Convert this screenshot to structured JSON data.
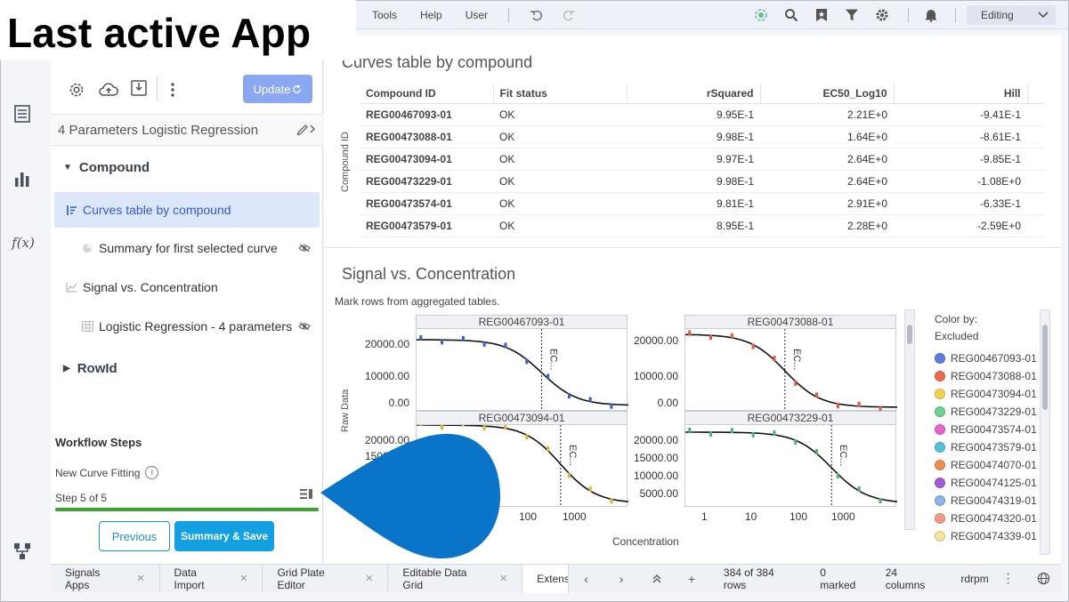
{
  "caption": "Last active App",
  "topbar": {
    "menus": [
      "Tools",
      "Help",
      "User"
    ],
    "mode": "Editing"
  },
  "panel": {
    "update_label": "Update",
    "app_title": "4 Parameters Logistic Regression",
    "groups": {
      "compound": "Compound",
      "rowid": "RowId"
    },
    "items": {
      "curves_table": "Curves table by compound",
      "summary": "Summary for first selected curve",
      "signal_vs_conc": "Signal vs. Concentration",
      "logistic": "Logistic Regression - 4 parameters"
    },
    "workflow": {
      "title": "Workflow Steps",
      "name": "New Curve Fitting",
      "step": "Step 5 of 5",
      "progress": 1.0,
      "previous": "Previous",
      "save": "Summary & Save"
    }
  },
  "table": {
    "title": "Curves table by compound",
    "row_axis_label": "Compound ID",
    "columns": [
      "Compound ID",
      "Fit status",
      "rSquared",
      "EC50_Log10",
      "Hill"
    ],
    "rows": [
      [
        "REG00467093-01",
        "OK",
        "9.95E-1",
        "2.21E+0",
        "-9.41E-1"
      ],
      [
        "REG00473088-01",
        "OK",
        "9.98E-1",
        "1.64E+0",
        "-8.61E-1"
      ],
      [
        "REG00473094-01",
        "OK",
        "9.97E-1",
        "2.64E+0",
        "-9.85E-1"
      ],
      [
        "REG00473229-01",
        "OK",
        "9.98E-1",
        "2.64E+0",
        "-1.08E+0"
      ],
      [
        "REG00473574-01",
        "OK",
        "9.81E-1",
        "2.91E+0",
        "-6.33E-1"
      ],
      [
        "REG00473579-01",
        "OK",
        "8.95E-1",
        "2.28E+0",
        "-2.59E+0"
      ]
    ]
  },
  "plot": {
    "title": "Signal vs. Concentration",
    "subtitle": "Mark rows from aggregated tables.",
    "y_axis_title": "Raw Data",
    "x_axis_title": "Concentration",
    "ec_label": "EC...",
    "panels": [
      {
        "name": "REG00467093-01",
        "yticks": [
          "20000.00",
          "10000.00",
          "0.00"
        ],
        "xticks": []
      },
      {
        "name": "REG00473088-01",
        "yticks": [
          "20000.00",
          "10000.00",
          "0.00"
        ],
        "xticks": []
      },
      {
        "name": "REG00473094-01",
        "yticks": [
          "20000.00",
          "15000.00"
        ],
        "xticks": [
          "100",
          "1000"
        ]
      },
      {
        "name": "REG00473229-01",
        "yticks": [
          "20000.00",
          "15000.00",
          "10000.00",
          "5000.00"
        ],
        "xticks": [
          "1",
          "10",
          "100",
          "1000"
        ]
      }
    ],
    "legend": {
      "title_1": "Color by:",
      "title_2": "Excluded",
      "items": [
        {
          "label": "REG00467093-01",
          "color": "#5b7de0"
        },
        {
          "label": "REG00473088-01",
          "color": "#ee6a50"
        },
        {
          "label": "REG00473094-01",
          "color": "#f2d34a"
        },
        {
          "label": "REG00473229-01",
          "color": "#6fd08f"
        },
        {
          "label": "REG00473574-01",
          "color": "#e864c9"
        },
        {
          "label": "REG00473579-01",
          "color": "#4fc3d8"
        },
        {
          "label": "REG00474070-01",
          "color": "#ef8d4f"
        },
        {
          "label": "REG00474125-01",
          "color": "#a35bd6"
        },
        {
          "label": "REG00474319-01",
          "color": "#8fb1ee"
        },
        {
          "label": "REG00474320-01",
          "color": "#f39b86"
        },
        {
          "label": "REG00474339-01",
          "color": "#f7e39a"
        }
      ]
    }
  },
  "bottom": {
    "tabs": [
      "Signals Apps",
      "Data Import",
      "Grid Plate Editor",
      "Editable Data Grid",
      "Extensi"
    ],
    "rows": "384 of 384 rows",
    "marked": "0 marked",
    "columns": "24 columns",
    "user": "rdrpm"
  }
}
